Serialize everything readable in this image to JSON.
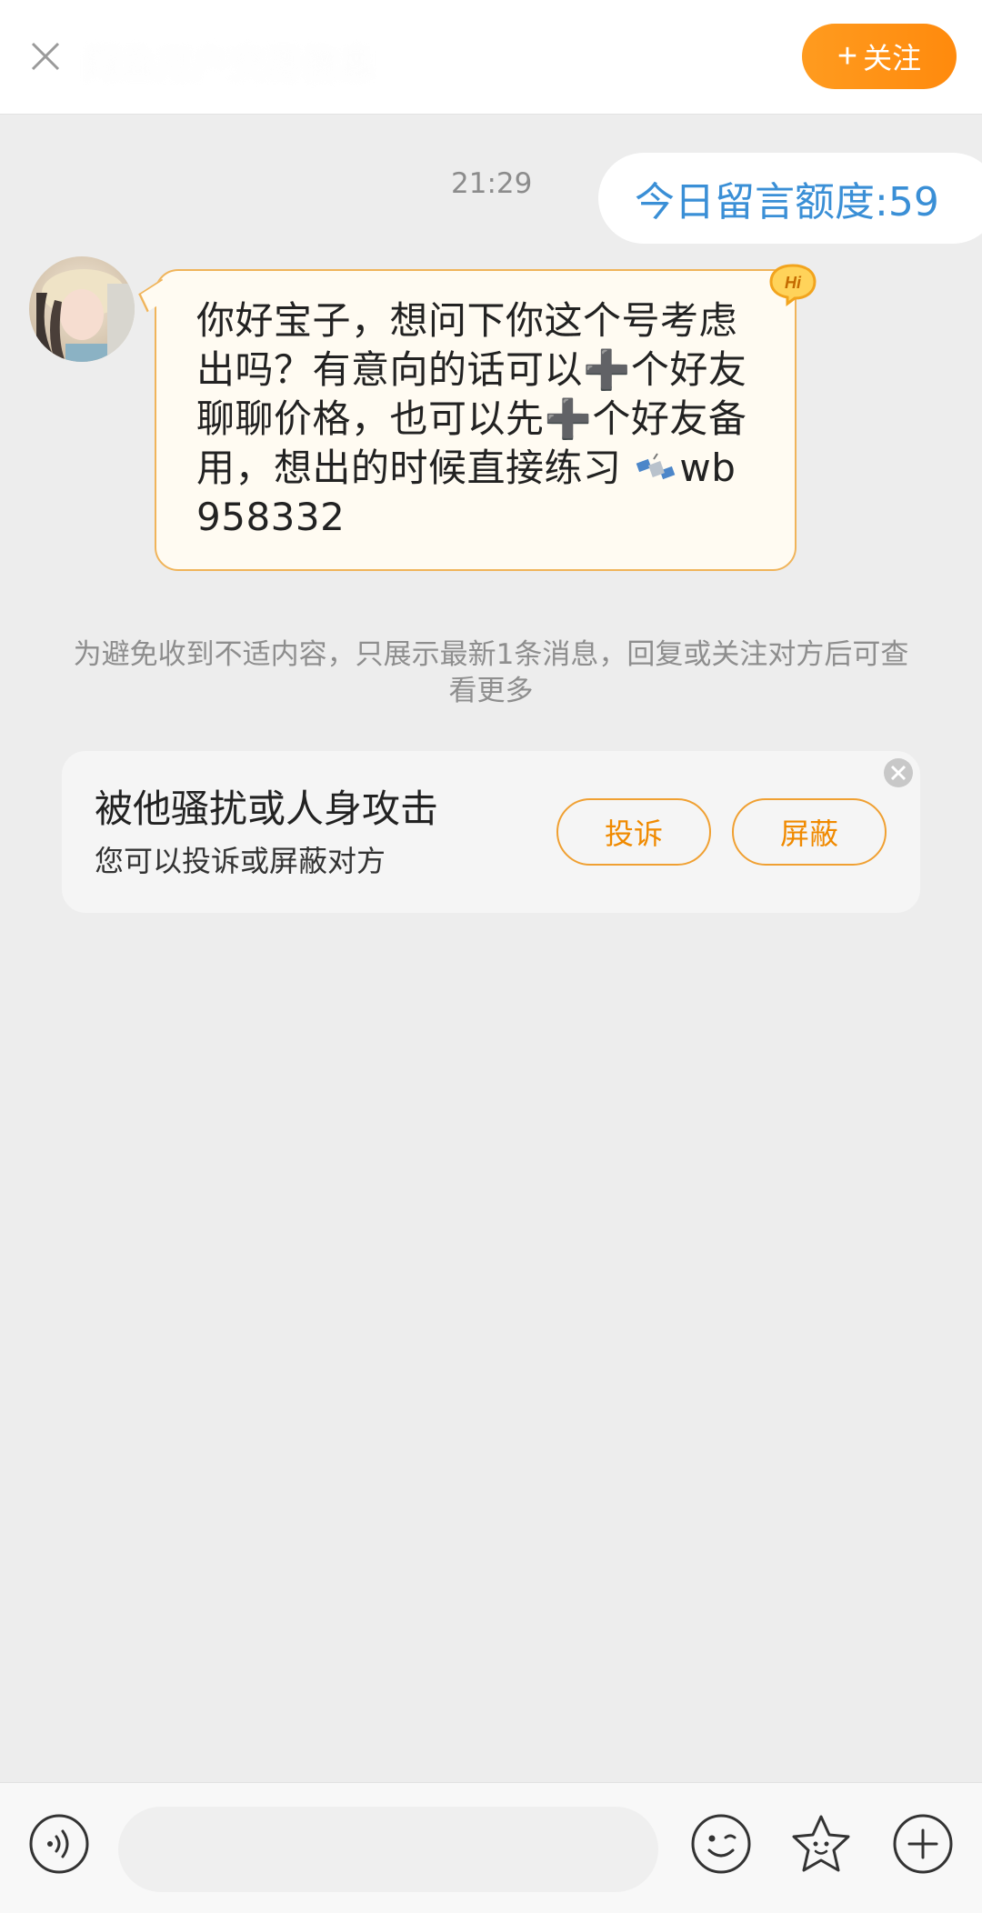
{
  "header": {
    "title": "闲鱼用户交易信息",
    "follow_label": "关注"
  },
  "chat": {
    "timestamp": "21:29",
    "quota_text": "今日留言额度:59",
    "message_part1": "你好宝子，想问下你这个号考虑出吗？有意向的话可以",
    "plus_glyph": "➕",
    "message_part2": "个好友聊聊价格，也可以先",
    "message_part3": "个好友备用，想出的时候直接练习 ",
    "message_id": "wb958332",
    "hi_badge": "Hi",
    "notice": "为避免收到不适内容，只展示最新1条消息，回复或关注对方后可查看更多"
  },
  "report_card": {
    "title": "被他骚扰或人身攻击",
    "subtitle": "您可以投诉或屏蔽对方",
    "complain_label": "投诉",
    "block_label": "屏蔽"
  },
  "input_bar": {
    "placeholder": ""
  },
  "colors": {
    "accent": "#ff8a0d",
    "quota_blue": "#3a8fd6",
    "bubble_border": "#f0b45a",
    "background": "#ededed"
  }
}
